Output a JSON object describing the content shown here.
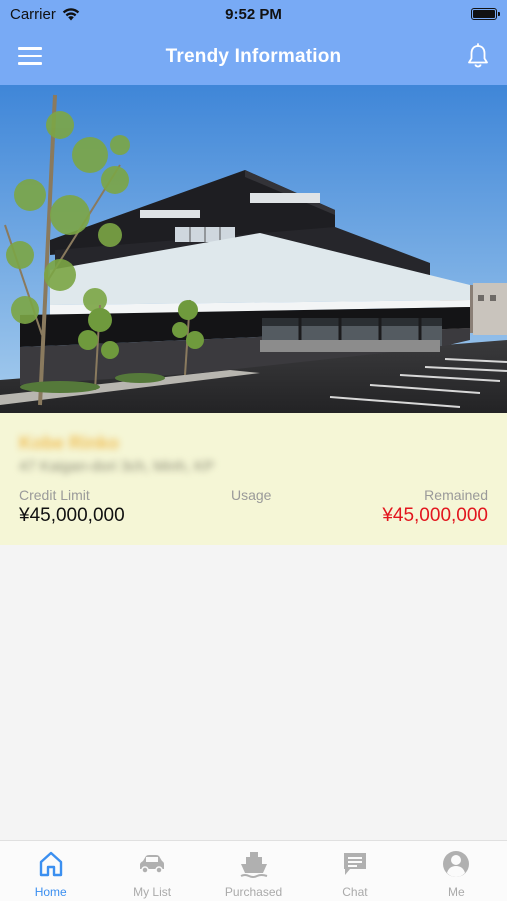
{
  "status_bar": {
    "carrier": "Carrier",
    "time": "9:52 PM",
    "battery_level": 1.0
  },
  "nav": {
    "title": "Trendy Information"
  },
  "card": {
    "company_name": "Kobe Rinko",
    "company_address": "47 Kaigan-dori 3ch, Minh, KP",
    "credit_limit_label": "Credit Limit",
    "credit_limit_value": "¥45,000,000",
    "usage_label": "Usage",
    "usage_value": "",
    "remained_label": "Remained",
    "remained_value": "¥45,000,000"
  },
  "tabs": [
    {
      "label": "Home",
      "icon": "home-icon",
      "active": true
    },
    {
      "label": "My List",
      "icon": "car-icon",
      "active": false
    },
    {
      "label": "Purchased",
      "icon": "ship-icon",
      "active": false
    },
    {
      "label": "Chat",
      "icon": "chat-icon",
      "active": false
    },
    {
      "label": "Me",
      "icon": "person-icon",
      "active": false
    }
  ],
  "colors": {
    "accent": "#78aaf5",
    "active_tab": "#3b8ff0",
    "inactive_tab": "#aaaaaa",
    "remained": "#e2161e",
    "card_bg": "#f5f6d6"
  }
}
